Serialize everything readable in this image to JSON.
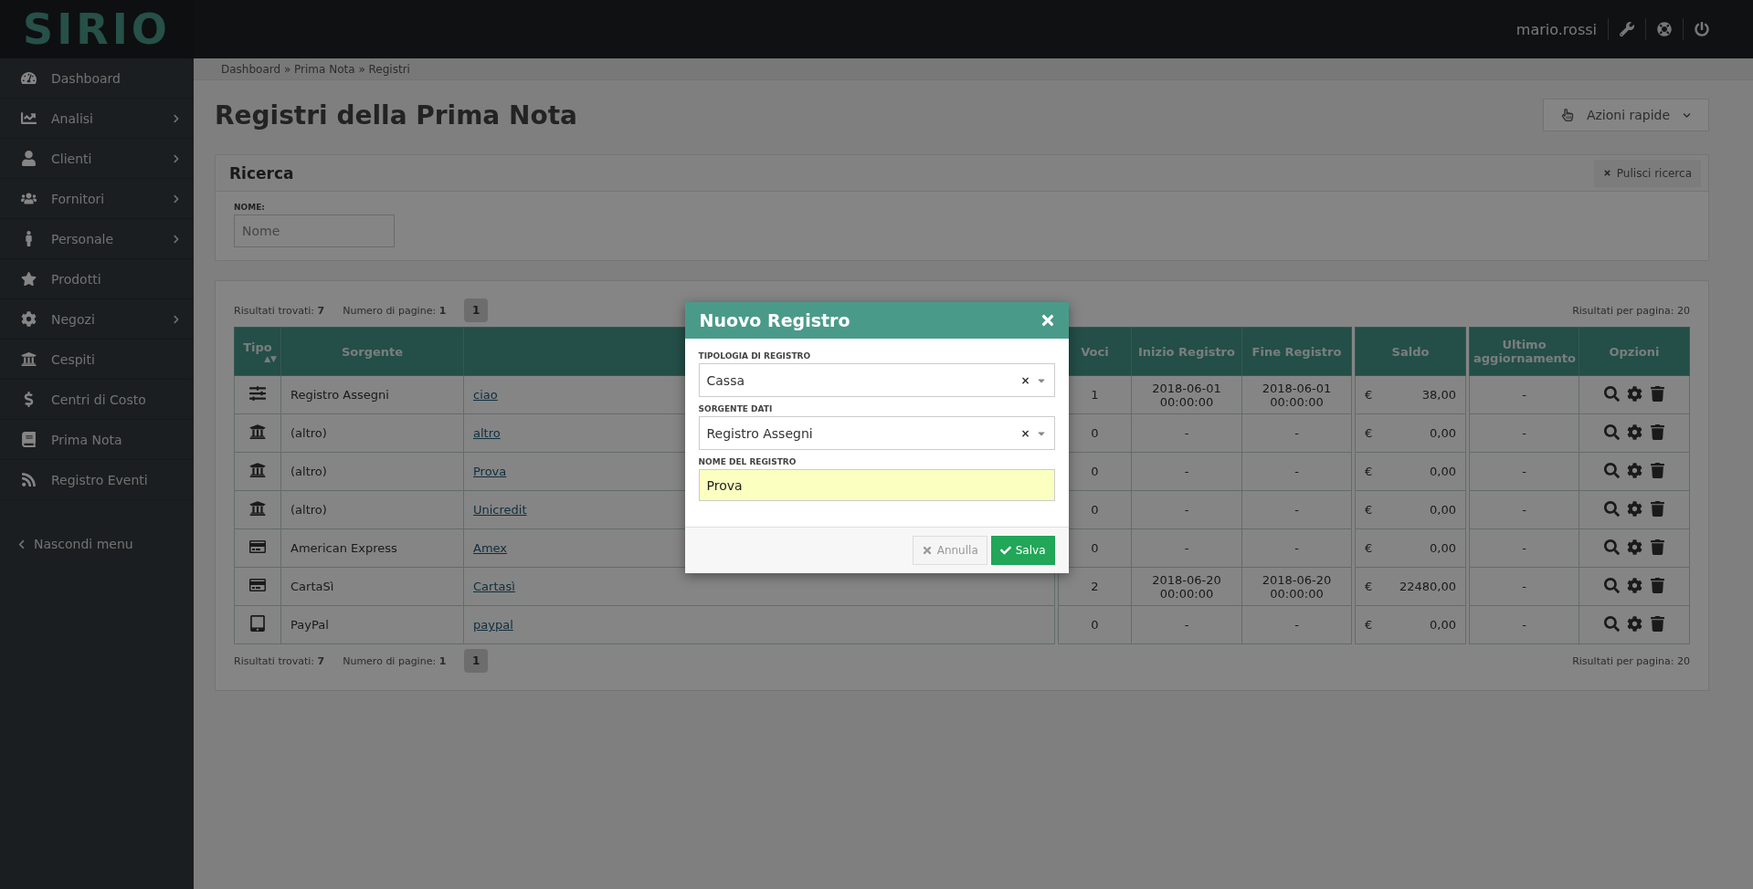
{
  "logo": "SIRIO",
  "topbar": {
    "user": "mario.rossi"
  },
  "sidebar": {
    "items": [
      {
        "label": "Dashboard",
        "has_submenu": false
      },
      {
        "label": "Analisi",
        "has_submenu": true
      },
      {
        "label": "Clienti",
        "has_submenu": true
      },
      {
        "label": "Fornitori",
        "has_submenu": true
      },
      {
        "label": "Personale",
        "has_submenu": true
      },
      {
        "label": "Prodotti",
        "has_submenu": false
      },
      {
        "label": "Negozi",
        "has_submenu": true
      },
      {
        "label": "Cespiti",
        "has_submenu": false
      },
      {
        "label": "Centri di Costo",
        "has_submenu": false
      },
      {
        "label": "Prima Nota",
        "has_submenu": false
      },
      {
        "label": "Registro Eventi",
        "has_submenu": false
      }
    ],
    "hide_menu": "Nascondi menu"
  },
  "breadcrumb": "Dashboard » Prima Nota » Registri",
  "page_title": "Registri della Prima Nota",
  "quick_actions": "Azioni rapide",
  "search": {
    "title": "Ricerca",
    "clear": "Pulisci ricerca",
    "field_label": "NOME:",
    "placeholder": "Nome"
  },
  "pagers": [
    {
      "found_label": "Risultati trovati:",
      "found": "7",
      "pages_label": "Numero di pagine:",
      "pages": "1",
      "page_buttons": [
        {
          "label": "1",
          "selected": true
        }
      ],
      "per_page": "Risultati per pagina: 20"
    },
    {
      "found_label": "Risultati trovati:",
      "found": "7",
      "pages_label": "Numero di pagine:",
      "pages": "1",
      "page_buttons": [
        {
          "label": "1",
          "selected": true
        }
      ],
      "per_page": "Risultati per pagina: 20"
    }
  ],
  "table": {
    "columns": [
      {
        "label": "Tipo",
        "sort": "▲▼"
      },
      {
        "label": "Sorgente"
      },
      {},
      {
        "label": "Voci"
      },
      {
        "label": "Inizio Registro"
      },
      {
        "label": "Fine Registro"
      },
      {
        "label": "Saldo"
      },
      {
        "label": "Ultimo aggiornamento"
      },
      {
        "label": "Opzioni"
      }
    ],
    "rows": [
      {
        "kind": "cheque",
        "source": "Registro Assegni",
        "name": "ciao",
        "entries": "1",
        "start": "2018-06-01 00:00:00",
        "end": "2018-06-01 00:00:00",
        "currency": "€",
        "balance": "38,00",
        "updated": "-"
      },
      {
        "kind": "bank",
        "source": "(altro)",
        "name": "altro",
        "entries": "0",
        "start": "-",
        "end": "-",
        "currency": "€",
        "balance": "0,00",
        "updated": "-"
      },
      {
        "kind": "bank",
        "source": "(altro)",
        "name": "Prova",
        "entries": "0",
        "start": "-",
        "end": "-",
        "currency": "€",
        "balance": "0,00",
        "updated": "-"
      },
      {
        "kind": "bank",
        "source": "(altro)",
        "name": "Unicredit",
        "entries": "0",
        "start": "-",
        "end": "-",
        "currency": "€",
        "balance": "0,00",
        "updated": "-"
      },
      {
        "kind": "card",
        "source": "American Express",
        "name": "Amex",
        "entries": "0",
        "start": "-",
        "end": "-",
        "currency": "€",
        "balance": "0,00",
        "updated": "-"
      },
      {
        "kind": "card",
        "source": "CartaSì",
        "name": "Cartasì",
        "entries": "2",
        "start": "2018-06-20 00:00:00",
        "end": "2018-06-20 00:00:00",
        "currency": "€",
        "balance": "22480,00",
        "updated": "-"
      },
      {
        "kind": "device",
        "source": "PayPal",
        "name": "paypal",
        "entries": "0",
        "start": "-",
        "end": "-",
        "currency": "€",
        "balance": "0,00",
        "updated": "-"
      }
    ]
  },
  "modal": {
    "title": "Nuovo Registro",
    "fields": [
      {
        "kind": "select",
        "label": "TIPOLOGIA DI REGISTRO",
        "value": "Cassa",
        "clear": "×"
      },
      {
        "kind": "select",
        "label": "SORGENTE DATI",
        "value": "Registro Assegni",
        "clear": "×"
      },
      {
        "kind": "text",
        "label": "NOME DEL REGISTRO",
        "value": "Prova",
        "highlighted": true
      }
    ],
    "buttons": [
      {
        "kind": "cancel",
        "label": "Annulla"
      },
      {
        "kind": "primary",
        "label": "Salva"
      }
    ]
  }
}
